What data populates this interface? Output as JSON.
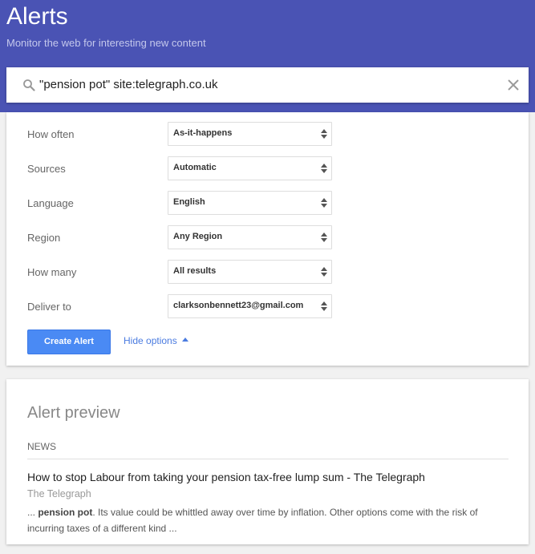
{
  "header": {
    "title": "Alerts",
    "subtitle": "Monitor the web for interesting new content",
    "background_color": "#4a53b4"
  },
  "search": {
    "value": "\"pension pot\" site:telegraph.co.uk",
    "search_icon": "search-icon",
    "clear_icon": "close-icon"
  },
  "options": [
    {
      "label": "How often",
      "value": "As-it-happens"
    },
    {
      "label": "Sources",
      "value": "Automatic"
    },
    {
      "label": "Language",
      "value": "English"
    },
    {
      "label": "Region",
      "value": "Any Region"
    },
    {
      "label": "How many",
      "value": "All results"
    },
    {
      "label": "Deliver to",
      "value": "clarksonbennett23@gmail.com"
    }
  ],
  "actions": {
    "create_label": "Create Alert",
    "create_color": "#4a8af4",
    "hide_options_label": "Hide options"
  },
  "preview": {
    "title": "Alert preview",
    "section_label": "NEWS",
    "results": [
      {
        "title": "How to stop Labour from taking your pension tax-free lump sum - The Telegraph",
        "source": "The Telegraph",
        "snippet_prefix": "... ",
        "snippet_bold": "pension pot",
        "snippet_rest": ". Its value could be whittled away over time by inflation. Other options come with the risk of incurring taxes of a different kind ..."
      }
    ]
  }
}
